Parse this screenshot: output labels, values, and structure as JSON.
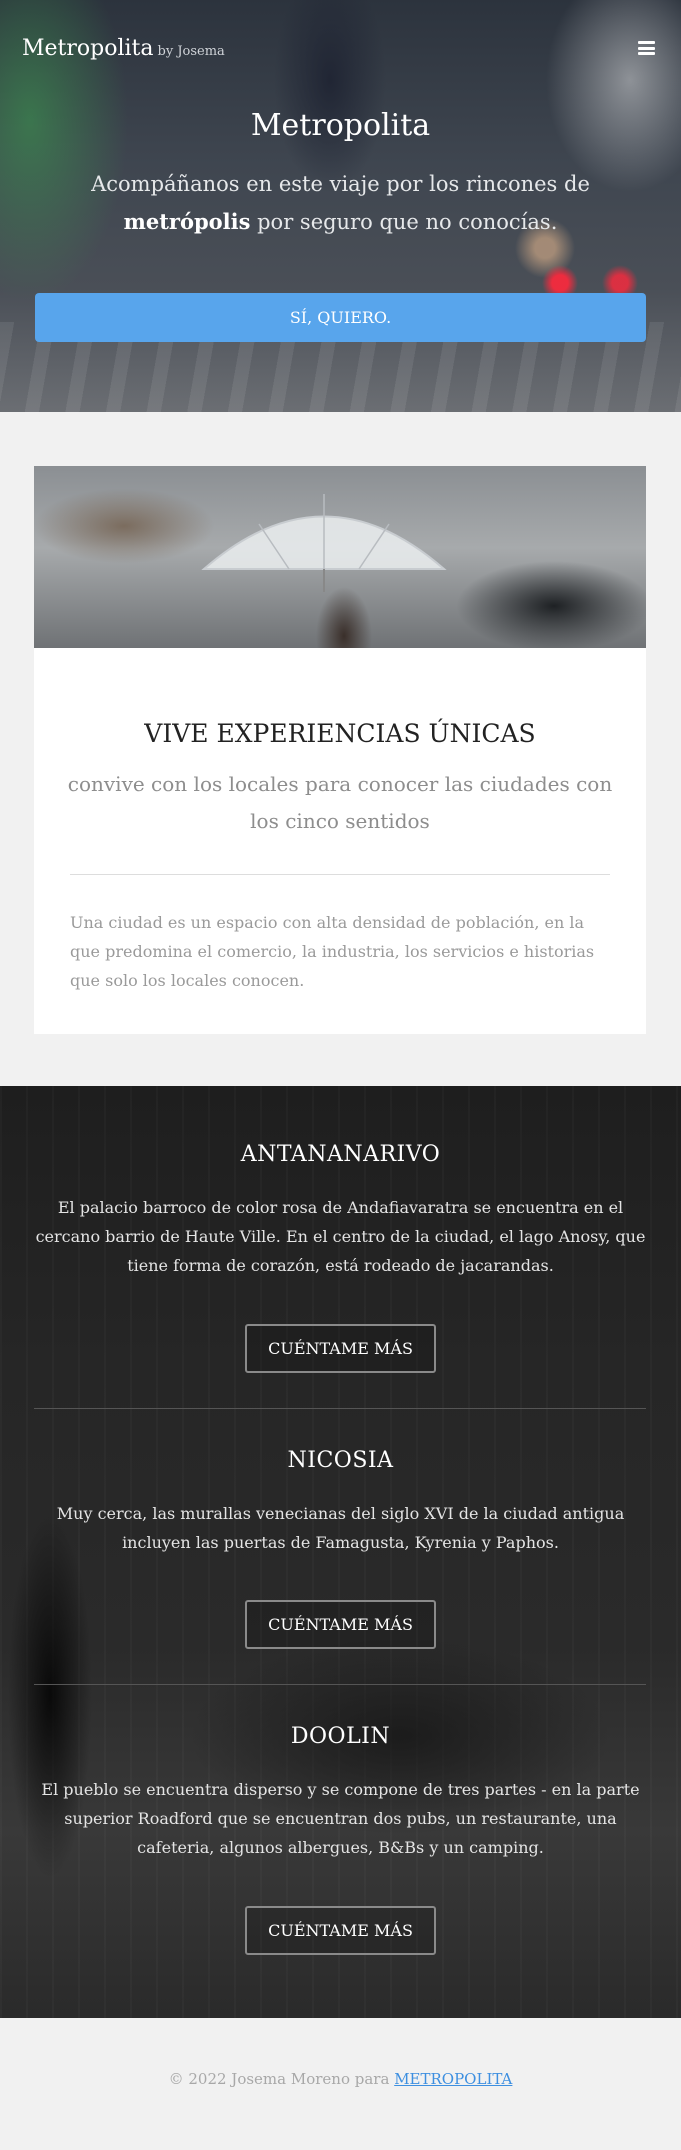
{
  "header": {
    "brand": "Metropolita",
    "brand_sub": "by Josema",
    "menu_icon": "hamburger-menu-icon"
  },
  "hero": {
    "title": "Metropolita",
    "text_before": "Acompáñanos en este viaje por los rincones de ",
    "text_bold": "metrópolis",
    "text_after": " por seguro que no conocías.",
    "button": "SÍ, QUIERO.",
    "button_color": "#58a5ec"
  },
  "feature": {
    "title": "VIVE EXPERIENCIAS ÚNICAS",
    "subtitle": "convive con los locales para conocer las ciudades con los cinco sentidos",
    "body": "Una ciudad es un espacio con alta densidad de población, en la que predomina el comercio, la industria, los servicios e historias que solo los locales conocen."
  },
  "cities": [
    {
      "name": "ANTANANARIVO",
      "text": "El palacio barroco de color rosa de Andafiavaratra se encuentra en el cercano barrio de Haute Ville. En el centro de la ciudad, el lago Anosy, que tiene forma de corazón, está rodeado de jacarandas.",
      "button": "CUÉNTAME MÁS"
    },
    {
      "name": "NICOSIA",
      "text": "Muy cerca, las murallas venecianas del siglo XVI de la ciudad antigua incluyen las puertas de Famagusta, Kyrenia y Paphos.",
      "button": "CUÉNTAME MÁS"
    },
    {
      "name": "DOOLIN",
      "text": "El pueblo se encuentra disperso y se compone de tres partes - en la parte superior Roadford que se encuentran dos pubs, un restaurante, una cafeteria, algunos albergues, B&Bs y un camping.",
      "button": "CUÉNTAME MÁS"
    }
  ],
  "footer": {
    "text": "© 2022 Josema Moreno para ",
    "link": "METROPOLITA",
    "link_color": "#3d8fe0"
  }
}
